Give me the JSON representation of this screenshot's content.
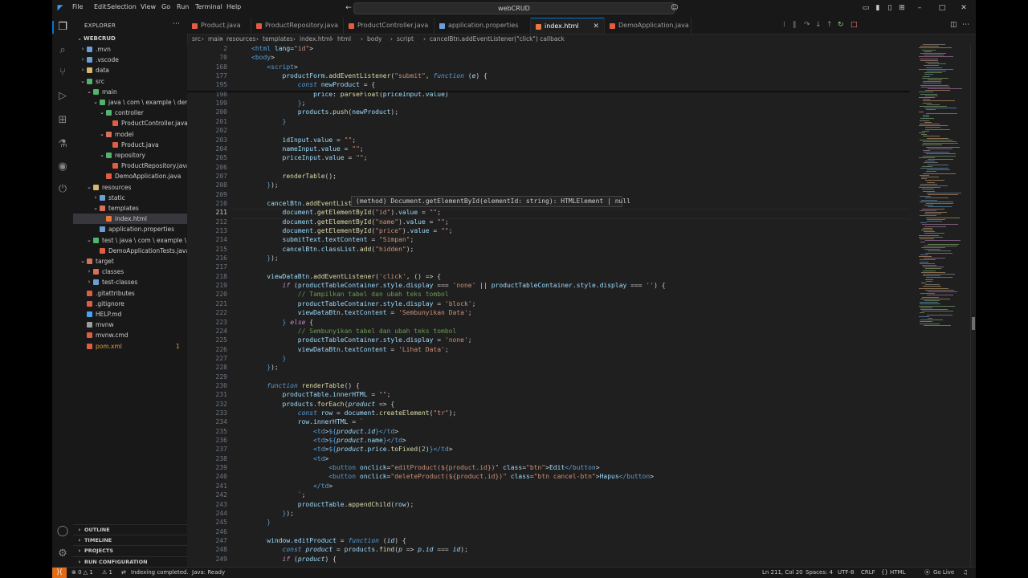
{
  "titlebar": {
    "menus": [
      "File",
      "Edit",
      "Selection",
      "View",
      "Go",
      "Run",
      "Terminal",
      "Help"
    ],
    "search_text": "webCRUD"
  },
  "sidebar": {
    "header": "EXPLORER",
    "root": "WEBCRUD",
    "items": [
      {
        "label": ".mvn",
        "depth": 1,
        "type": "folder",
        "state": "collapsed",
        "color": "#6a9fd6"
      },
      {
        "label": ".vscode",
        "depth": 1,
        "type": "folder",
        "state": "collapsed",
        "color": "#6a9fd6"
      },
      {
        "label": "data",
        "depth": 1,
        "type": "folder",
        "state": "collapsed",
        "color": "#d9b86a"
      },
      {
        "label": "src",
        "depth": 1,
        "type": "folder",
        "state": "expanded",
        "color": "#52b36f"
      },
      {
        "label": "main",
        "depth": 2,
        "type": "folder",
        "state": "expanded",
        "color": "#52b36f"
      },
      {
        "label": "java \\ com \\ example \\ demo",
        "depth": 3,
        "type": "folder",
        "state": "expanded",
        "color": "#52b36f"
      },
      {
        "label": "controller",
        "depth": 4,
        "type": "folder",
        "state": "expanded",
        "color": "#52b36f"
      },
      {
        "label": "ProductController.java",
        "depth": 5,
        "type": "file",
        "state": "",
        "color": "#e05d44"
      },
      {
        "label": "model",
        "depth": 4,
        "type": "folder",
        "state": "expanded",
        "color": "#d9705c"
      },
      {
        "label": "Product.java",
        "depth": 5,
        "type": "file",
        "state": "",
        "color": "#e05d44"
      },
      {
        "label": "repository",
        "depth": 4,
        "type": "folder",
        "state": "expanded",
        "color": "#52b36f"
      },
      {
        "label": "ProductRepository.java",
        "depth": 5,
        "type": "file",
        "state": "",
        "color": "#e05d44"
      },
      {
        "label": "DemoApplication.java",
        "depth": 4,
        "type": "file",
        "state": "",
        "color": "#e05d44"
      },
      {
        "label": "resources",
        "depth": 2,
        "type": "folder",
        "state": "expanded",
        "color": "#d9b86a"
      },
      {
        "label": "static",
        "depth": 3,
        "type": "folder",
        "state": "collapsed",
        "color": "#6a9fd6"
      },
      {
        "label": "templates",
        "depth": 3,
        "type": "folder",
        "state": "expanded",
        "color": "#d9705c"
      },
      {
        "label": "index.html",
        "depth": 4,
        "type": "file",
        "state": "selected",
        "color": "#e8783c"
      },
      {
        "label": "application.properties",
        "depth": 3,
        "type": "file",
        "state": "",
        "color": "#6a9fd6"
      },
      {
        "label": "test \\ java \\ com \\ example \\ demo",
        "depth": 2,
        "type": "folder",
        "state": "expanded",
        "color": "#52b36f"
      },
      {
        "label": "DemoApplicationTests.java",
        "depth": 3,
        "type": "file",
        "state": "",
        "color": "#e05d44"
      },
      {
        "label": "target",
        "depth": 1,
        "type": "folder",
        "state": "expanded",
        "color": "#d9705c"
      },
      {
        "label": "classes",
        "depth": 2,
        "type": "folder",
        "state": "collapsed",
        "color": "#d9705c"
      },
      {
        "label": "test-classes",
        "depth": 2,
        "type": "folder",
        "state": "collapsed",
        "color": "#6a9fd6"
      },
      {
        "label": ".gitattributes",
        "depth": 1,
        "type": "file",
        "state": "",
        "color": "#e05d44"
      },
      {
        "label": ".gitignore",
        "depth": 1,
        "type": "file",
        "state": "",
        "color": "#e05d44"
      },
      {
        "label": "HELP.md",
        "depth": 1,
        "type": "file",
        "state": "",
        "color": "#42a5f5"
      },
      {
        "label": "mvnw",
        "depth": 1,
        "type": "file",
        "state": "",
        "color": "#9e9e9e"
      },
      {
        "label": "mvnw.cmd",
        "depth": 1,
        "type": "file",
        "state": "",
        "color": "#e05d44"
      },
      {
        "label": "pom.xml",
        "depth": 1,
        "type": "file",
        "state": "modified",
        "color": "#e05d44",
        "badge": "1"
      }
    ],
    "sections": [
      "OUTLINE",
      "TIMELINE",
      "PROJECTS",
      "RUN CONFIGURATION"
    ]
  },
  "tabs": [
    {
      "label": "Product.java",
      "color": "#e05d44",
      "active": false
    },
    {
      "label": "ProductRepository.java",
      "color": "#e05d44",
      "active": false
    },
    {
      "label": "ProductController.java",
      "color": "#e05d44",
      "active": false
    },
    {
      "label": "application.properties",
      "color": "#6a9fd6",
      "active": false
    },
    {
      "label": "index.html",
      "color": "#e8783c",
      "active": true
    },
    {
      "label": "DemoApplication.java",
      "color": "#e05d44",
      "active": false
    }
  ],
  "breadcrumbs": [
    "src",
    "main",
    "resources",
    "templates",
    "index.html",
    "html",
    "body",
    "script",
    "cancelBtn.addEventListener(\"click\") callback"
  ],
  "editor": {
    "current_line": "211",
    "hover_text": "(method) Document.getElementById(elementId: string): HTMLElement | null",
    "lines": [
      {
        "n": "2",
        "t": "<html lang=\"id\">",
        "sticky": true
      },
      {
        "n": "70",
        "t": "<body>",
        "sticky": true
      },
      {
        "n": "168",
        "t": "    <script>",
        "sticky": true
      },
      {
        "n": "177",
        "t": "        productForm.addEventListener(\"submit\", function (e) {",
        "sticky": true
      },
      {
        "n": "195",
        "t": "            const newProduct = {",
        "sticky": true
      },
      {
        "n": "198",
        "t": "                price: parseFloat(priceInput.value)"
      },
      {
        "n": "199",
        "t": "            };"
      },
      {
        "n": "200",
        "t": "            products.push(newProduct);"
      },
      {
        "n": "201",
        "t": "        }"
      },
      {
        "n": "202",
        "t": ""
      },
      {
        "n": "203",
        "t": "        idInput.value = \"\";"
      },
      {
        "n": "204",
        "t": "        nameInput.value = \"\";"
      },
      {
        "n": "205",
        "t": "        priceInput.value = \"\";"
      },
      {
        "n": "206",
        "t": ""
      },
      {
        "n": "207",
        "t": "        renderTable();"
      },
      {
        "n": "208",
        "t": "    });"
      },
      {
        "n": "209",
        "t": ""
      },
      {
        "n": "210",
        "t": "    cancelBtn.addEventListener(\"click\", function () {"
      },
      {
        "n": "211",
        "t": "        document.getElementById(\"id\").value = \"\";"
      },
      {
        "n": "212",
        "t": "        document.getElementById(\"name\").value = \"\";"
      },
      {
        "n": "213",
        "t": "        document.getElementById(\"price\").value = \"\";"
      },
      {
        "n": "214",
        "t": "        submitText.textContent = \"Simpan\";"
      },
      {
        "n": "215",
        "t": "        cancelBtn.classList.add(\"hidden\");"
      },
      {
        "n": "216",
        "t": "    });"
      },
      {
        "n": "217",
        "t": ""
      },
      {
        "n": "218",
        "t": "    viewDataBtn.addEventListener('click', () => {"
      },
      {
        "n": "219",
        "t": "        if (productTableContainer.style.display === 'none' || productTableContainer.style.display === '') {"
      },
      {
        "n": "220",
        "t": "            // Tampilkan tabel dan ubah teks tombol"
      },
      {
        "n": "221",
        "t": "            productTableContainer.style.display = 'block';"
      },
      {
        "n": "222",
        "t": "            viewDataBtn.textContent = 'Sembunyikan Data';"
      },
      {
        "n": "223",
        "t": "        } else {"
      },
      {
        "n": "224",
        "t": "            // Sembunyikan tabel dan ubah teks tombol"
      },
      {
        "n": "225",
        "t": "            productTableContainer.style.display = 'none';"
      },
      {
        "n": "226",
        "t": "            viewDataBtn.textContent = 'Lihat Data';"
      },
      {
        "n": "227",
        "t": "        }"
      },
      {
        "n": "228",
        "t": "    });"
      },
      {
        "n": "229",
        "t": ""
      },
      {
        "n": "230",
        "t": "    function renderTable() {"
      },
      {
        "n": "231",
        "t": "        productTable.innerHTML = \"\";"
      },
      {
        "n": "232",
        "t": "        products.forEach(product => {"
      },
      {
        "n": "233",
        "t": "            const row = document.createElement(\"tr\");"
      },
      {
        "n": "234",
        "t": "            row.innerHTML = `"
      },
      {
        "n": "235",
        "t": "                <td>${product.id}</td>"
      },
      {
        "n": "236",
        "t": "                <td>${product.name}</td>"
      },
      {
        "n": "237",
        "t": "                <td>${product.price.toFixed(2)}</td>"
      },
      {
        "n": "238",
        "t": "                <td>"
      },
      {
        "n": "239",
        "t": "                    <button onclick=\"editProduct(${product.id})\" class=\"btn\">Edit</button>"
      },
      {
        "n": "240",
        "t": "                    <button onclick=\"deleteProduct(${product.id})\" class=\"btn cancel-btn\">Hapus</button>"
      },
      {
        "n": "241",
        "t": "                </td>"
      },
      {
        "n": "242",
        "t": "            `;"
      },
      {
        "n": "243",
        "t": "            productTable.appendChild(row);"
      },
      {
        "n": "244",
        "t": "        });"
      },
      {
        "n": "245",
        "t": "    }"
      },
      {
        "n": "246",
        "t": ""
      },
      {
        "n": "247",
        "t": "    window.editProduct = function (id) {"
      },
      {
        "n": "248",
        "t": "        const product = products.find(p => p.id === id);"
      },
      {
        "n": "249",
        "t": "        if (product) {"
      }
    ]
  },
  "statusbar": {
    "problems": "⊗ 0 △ 1",
    "warnings": "⚠ 1",
    "indexing": "Indexing completed.",
    "java": "Java: Ready",
    "position": "Ln 211, Col 20",
    "spaces": "Spaces: 4",
    "encoding": "UTF-8",
    "eol": "CRLF",
    "language": "HTML",
    "golive": "Go Live"
  }
}
